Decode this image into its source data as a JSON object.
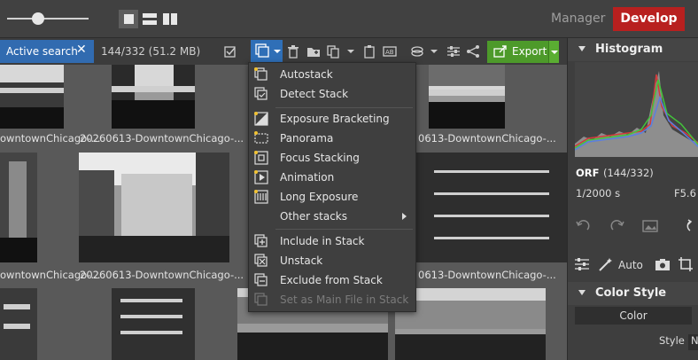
{
  "topbar": {
    "manager_label": "Manager",
    "develop_label": "Develop",
    "develop_color": "#b8201f"
  },
  "toolbar": {
    "active_search_label": "Active search",
    "close_glyph": "✕",
    "count_label": "144/332 (51.2 MB)",
    "export_label": "Export",
    "accent_color": "#316bb0",
    "export_color": "#4d9a2a"
  },
  "grid": {
    "captions": [
      "owntownChicago-...",
      "20260613-DowntownChicago-...",
      "0613-DowntownChicago-...",
      "owntownChicago-...",
      "20260613-DowntownChicago-...",
      "0613-DowntownChicago-..."
    ]
  },
  "menu": {
    "items": [
      {
        "label": "Autostack",
        "icon": "autostack-icon"
      },
      {
        "label": "Detect Stack",
        "icon": "detect-stack-icon"
      },
      {
        "label": "Exposure Bracketing",
        "icon": "exposure-bracketing-icon"
      },
      {
        "label": "Panorama",
        "icon": "panorama-icon"
      },
      {
        "label": "Focus Stacking",
        "icon": "focus-stacking-icon"
      },
      {
        "label": "Animation",
        "icon": "animation-icon"
      },
      {
        "label": "Long Exposure",
        "icon": "long-exposure-icon"
      },
      {
        "label": "Other stacks",
        "icon": ""
      },
      {
        "label": "Include in Stack",
        "icon": "include-in-stack-icon"
      },
      {
        "label": "Unstack",
        "icon": "unstack-icon"
      },
      {
        "label": "Exclude from Stack",
        "icon": "exclude-from-stack-icon"
      },
      {
        "label": "Set as Main File in Stack",
        "icon": "set-main-file-icon"
      }
    ]
  },
  "panel": {
    "histogram_title": "Histogram",
    "format": "ORF",
    "index": "(144/332)",
    "shutter": "1/2000 s",
    "aperture": "F5.6",
    "auto_label": "Auto",
    "color_style_title": "Color Style",
    "color_button": "Color",
    "style_label": "Style",
    "style_value": "N"
  }
}
